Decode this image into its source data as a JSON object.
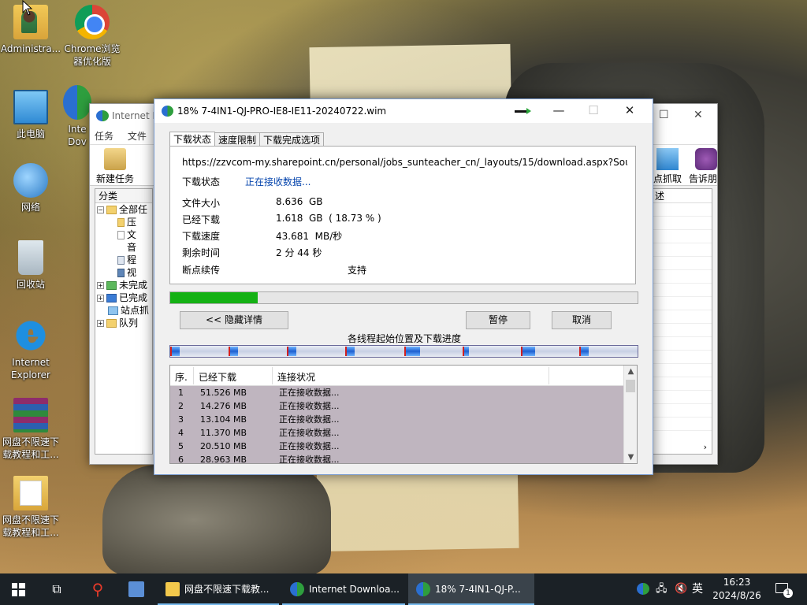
{
  "desktop": {
    "icons": [
      {
        "label": "Administra...",
        "icon": "user-folder-icon"
      },
      {
        "label": "Chrome浏览器优化版",
        "icon": "chrome-icon"
      },
      {
        "label": "此电脑",
        "icon": "computer-icon"
      },
      {
        "label": "Inte Dov",
        "icon": "idm-icon"
      },
      {
        "label": "网络",
        "icon": "network-icon"
      },
      {
        "label": "回收站",
        "icon": "recycle-bin-icon"
      },
      {
        "label": "Internet Explorer",
        "icon": "ie-icon"
      },
      {
        "label": "网盘不限速下载教程和工...",
        "icon": "winrar-icon"
      },
      {
        "label": "网盘不限速下载教程和工...",
        "icon": "folder-document-icon"
      }
    ]
  },
  "main_window": {
    "title": "Internet D",
    "menu": [
      "任务",
      "文件"
    ],
    "toolbar": {
      "new_task": "新建任务",
      "grab": "点抓取",
      "tell": "告诉朋"
    },
    "tree": {
      "header": "分类",
      "items": [
        "全部任",
        "压",
        "文",
        "音",
        "程",
        "视",
        "未完成",
        "已完成",
        "站点抓",
        "队列"
      ]
    },
    "list_header": "述"
  },
  "dialog": {
    "title": "18% 7-4IN1-QJ-PRO-IE8-IE11-20240722.wim",
    "tabs": [
      "下载状态",
      "速度限制",
      "下载完成选项"
    ],
    "url": "https://zzvcom-my.sharepoint.cn/personal/jobs_sunteacher_cn/_layouts/15/download.aspx?SourceUrl=",
    "status": {
      "label": "下载状态",
      "value": "正在接收数据..."
    },
    "info": [
      {
        "label": "文件大小",
        "value": "8.636  GB"
      },
      {
        "label": "已经下载",
        "value": "1.618  GB  ( 18.73 % )"
      },
      {
        "label": "下载速度",
        "value": "43.681  MB/秒"
      },
      {
        "label": "剩余时间",
        "value": "2 分 44 秒"
      },
      {
        "label": "断点续传",
        "value": "支持"
      }
    ],
    "progress_percent": 18.73,
    "buttons": {
      "hide_details": "<< 隐藏详情",
      "pause": "暂停",
      "cancel": "取消"
    },
    "segments_label": "各线程起始位置及下载进度",
    "segments": [
      {
        "start": 0.0,
        "done": 0.02
      },
      {
        "start": 0.125,
        "done": 0.02
      },
      {
        "start": 0.25,
        "done": 0.02
      },
      {
        "start": 0.375,
        "done": 0.02
      },
      {
        "start": 0.5,
        "done": 0.033
      },
      {
        "start": 0.625,
        "done": 0.01
      },
      {
        "start": 0.75,
        "done": 0.03
      },
      {
        "start": 0.875,
        "done": 0.02
      }
    ],
    "connections": {
      "columns": [
        "序.",
        "已经下载",
        "连接状况"
      ],
      "rows": [
        {
          "n": "1",
          "downloaded": "51.526  MB",
          "status": "正在接收数据..."
        },
        {
          "n": "2",
          "downloaded": "14.276  MB",
          "status": "正在接收数据..."
        },
        {
          "n": "3",
          "downloaded": "13.104  MB",
          "status": "正在接收数据..."
        },
        {
          "n": "4",
          "downloaded": "11.370  MB",
          "status": "正在接收数据..."
        },
        {
          "n": "5",
          "downloaded": "20.510  MB",
          "status": "正在接收数据..."
        },
        {
          "n": "6",
          "downloaded": "28.963  MB",
          "status": "正在接收数据..."
        }
      ]
    }
  },
  "taskbar": {
    "items": [
      {
        "label": "网盘不限速下载教...",
        "icon": "folder-icon"
      },
      {
        "label": "Internet Downloa...",
        "icon": "idm-icon"
      },
      {
        "label": "18% 7-4IN1-QJ-P...",
        "icon": "idm-icon"
      }
    ],
    "ime": "英",
    "time": "16:23",
    "date": "2024/8/26",
    "notification_count": "1"
  },
  "chart_data": {
    "type": "bar",
    "title": "各线程起始位置及下载进度",
    "categories": [
      "1",
      "2",
      "3",
      "4",
      "5",
      "6"
    ],
    "series": [
      {
        "name": "已经下载",
        "values": [
          51.526,
          14.276,
          13.104,
          11.37,
          20.51,
          28.963
        ]
      }
    ],
    "ylabel": "MB",
    "overall_progress_percent": 18.73
  }
}
